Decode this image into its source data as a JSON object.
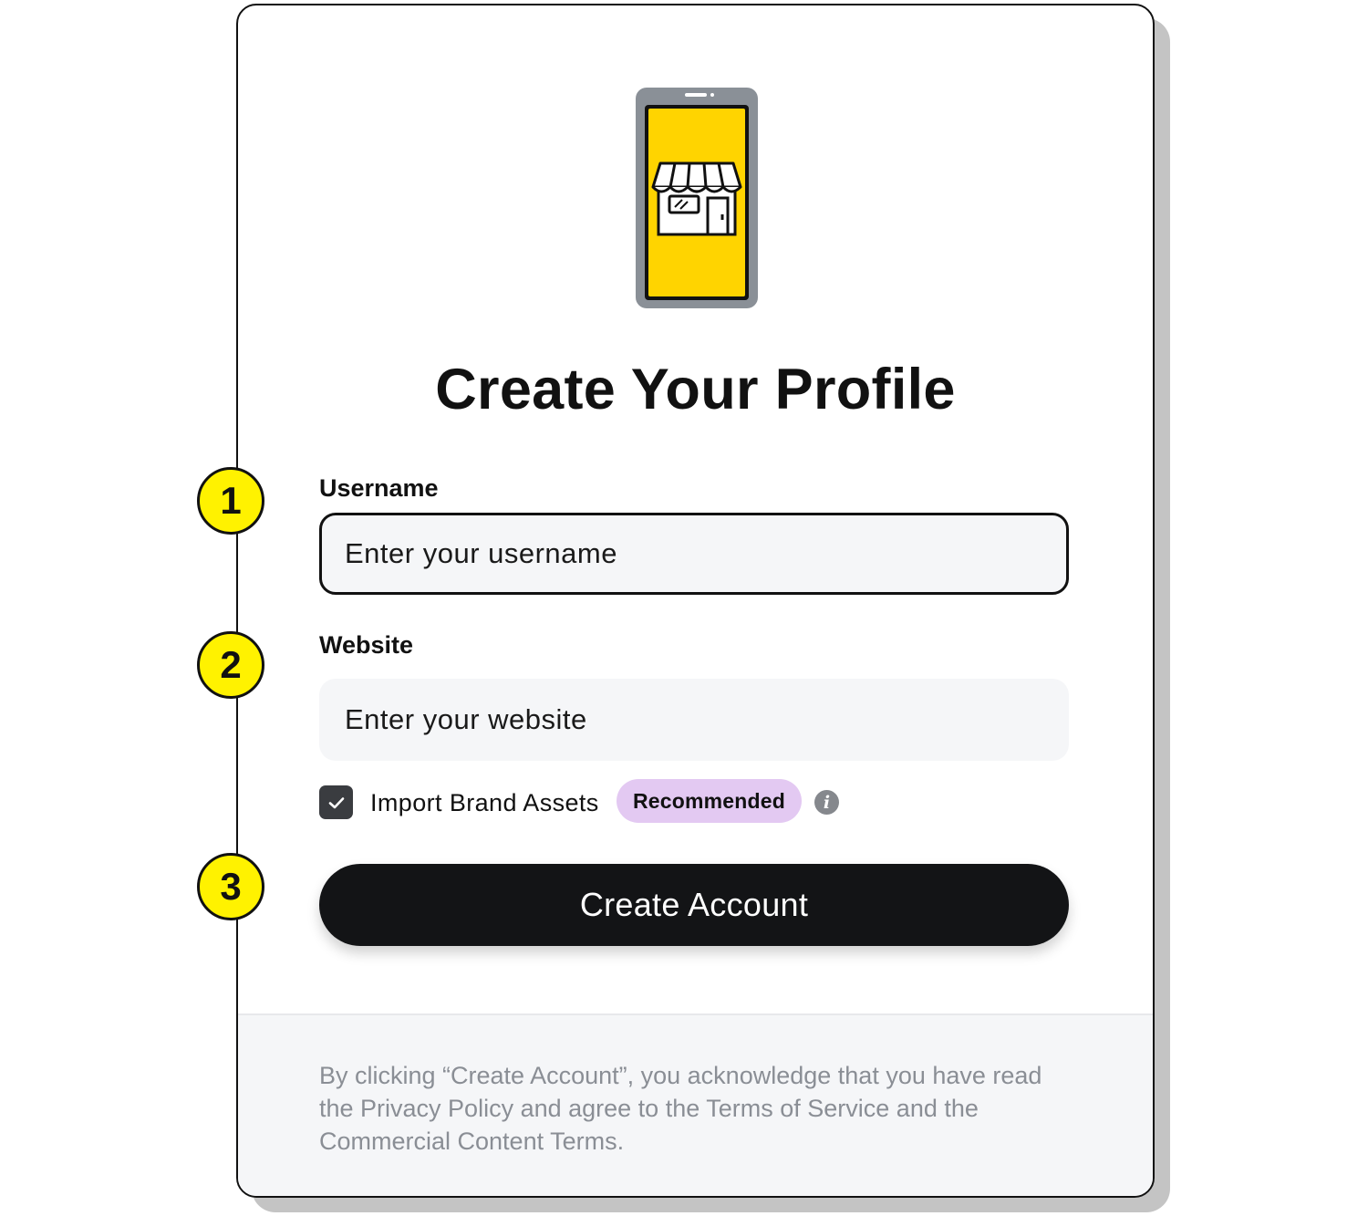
{
  "colors": {
    "accent_yellow": "#ffd400",
    "callout_yellow": "#fff200",
    "badge_purple": "#e3c9f2",
    "button_dark": "#131416",
    "input_bg": "#f5f6f8",
    "disclaimer_gray": "#8a8e95"
  },
  "illustration": {
    "icon": "storefront-on-phone-icon"
  },
  "page": {
    "title": "Create Your Profile"
  },
  "username": {
    "label": "Username",
    "placeholder": "Enter your username",
    "value": ""
  },
  "website": {
    "label": "Website",
    "placeholder": "Enter your website",
    "value": ""
  },
  "import_assets": {
    "checked": true,
    "label": "Import Brand Assets",
    "badge": "Recommended",
    "info_icon": "info-icon"
  },
  "submit": {
    "label": "Create Account"
  },
  "disclaimer": "By clicking “Create Account”, you acknowledge that you have read the Privacy Policy and agree to the Terms of Service and the Commercial Content Terms.",
  "callouts": [
    "1",
    "2",
    "3"
  ]
}
